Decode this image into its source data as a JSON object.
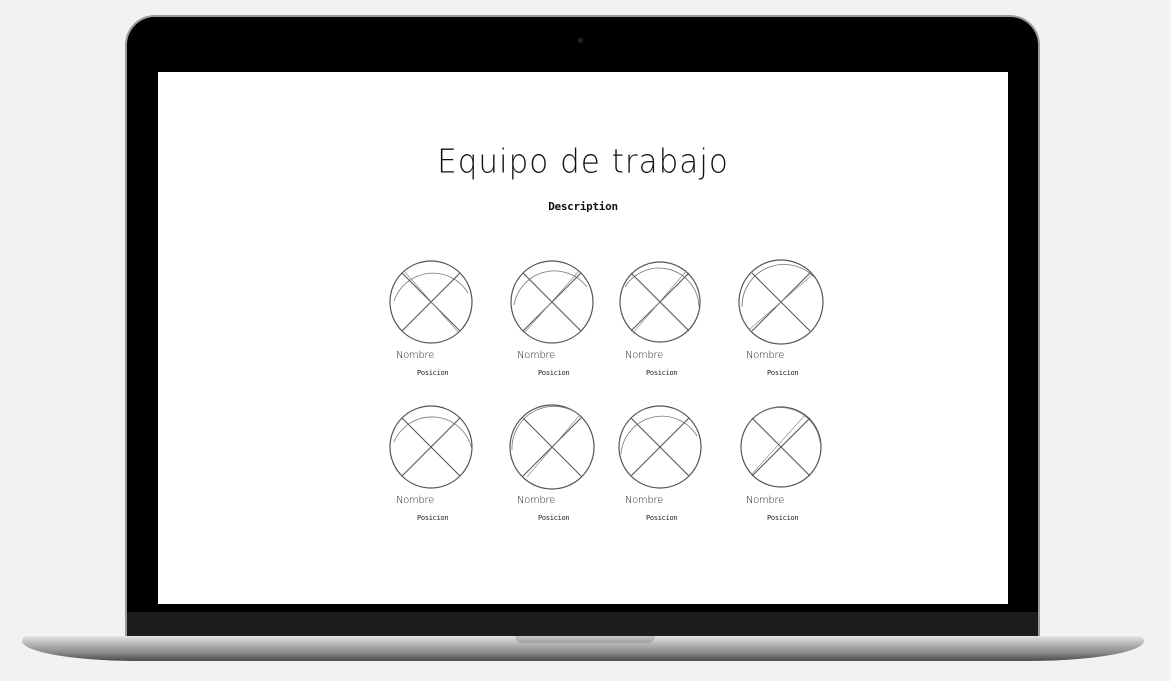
{
  "page": {
    "title": "Equipo de trabajo",
    "description": "Description"
  },
  "team": [
    {
      "name": "Nombre",
      "position": "Posicion",
      "photo_icon": "placeholder-x-icon"
    },
    {
      "name": "Nombre",
      "position": "Posicion",
      "photo_icon": "placeholder-x-icon"
    },
    {
      "name": "Nombre",
      "position": "Posicion",
      "photo_icon": "placeholder-x-icon"
    },
    {
      "name": "Nombre",
      "position": "Posicion",
      "photo_icon": "placeholder-x-icon"
    },
    {
      "name": "Nombre",
      "position": "Posicion",
      "photo_icon": "placeholder-x-icon"
    },
    {
      "name": "Nombre",
      "position": "Posicion",
      "photo_icon": "placeholder-x-icon"
    },
    {
      "name": "Nombre",
      "position": "Posicion",
      "photo_icon": "placeholder-x-icon"
    },
    {
      "name": "Nombre",
      "position": "Posicion",
      "photo_icon": "placeholder-x-icon"
    }
  ],
  "colors": {
    "sketch_stroke": "#555555",
    "laptop_frame": "#000000",
    "background": "#f2f2f2"
  }
}
